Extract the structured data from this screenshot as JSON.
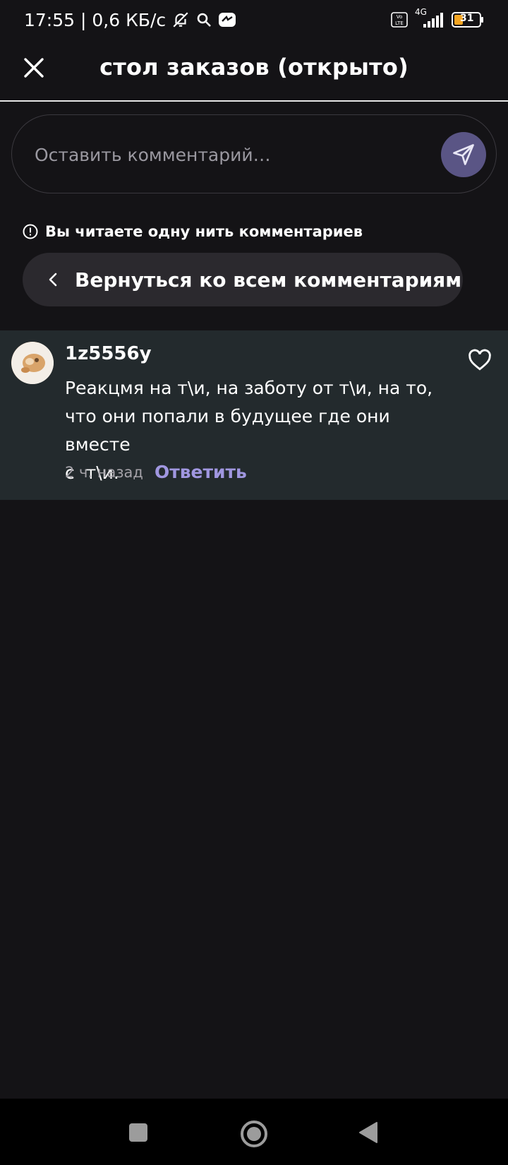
{
  "status_bar": {
    "time_speed": "17:55 | 0,6 КБ/с",
    "network_type": "4G",
    "volte": "Vo LTE",
    "battery": "31",
    "icons": [
      "bell-muted-icon",
      "search-icon",
      "app-icon",
      "volte-icon",
      "signal-icon",
      "battery-icon"
    ]
  },
  "header": {
    "title": "стол заказов (открыто)",
    "close_icon": "close-icon"
  },
  "composer": {
    "placeholder": "Оставить комментарий…",
    "send_icon": "send-icon"
  },
  "thread": {
    "notice": "Вы читаете одну нить комментариев",
    "back_label": "Вернуться ко всем комментариям"
  },
  "comment": {
    "username": "1z5556y",
    "text": "Реакцмя на т\\и, на заботу от т\\и, на то,\nчто они попали в будущее где они вместе\nс  т\\и.",
    "time_ago": "2 ч. назад",
    "reply_label": "Ответить",
    "liked": false
  },
  "nav": {
    "icons": [
      "recents-square-icon",
      "home-circle-icon",
      "back-triangle-icon"
    ]
  },
  "colors": {
    "background": "#141316",
    "card": "#232a2d",
    "accent": "#a097e0",
    "send_button": "#5a5585",
    "back_button": "#2b292e"
  }
}
